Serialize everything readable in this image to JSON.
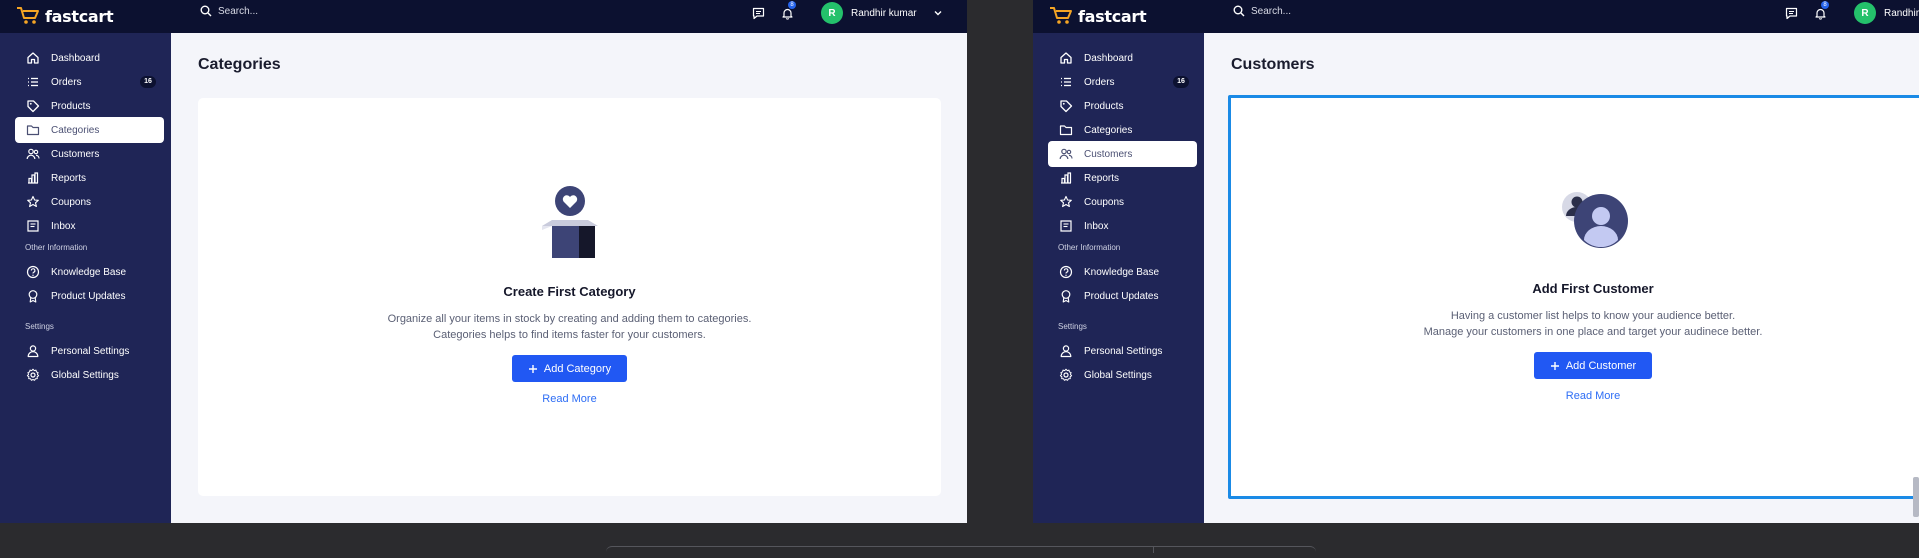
{
  "app": {
    "brand": "fastcart",
    "search_placeholder": "Search...",
    "notification_count": "8",
    "user": {
      "initial": "R",
      "name": "Randhir kumar",
      "name_clipped": "Randhir"
    }
  },
  "sidebar": {
    "items": [
      {
        "label": "Dashboard",
        "icon": "home-icon"
      },
      {
        "label": "Orders",
        "icon": "list-icon",
        "count": "16"
      },
      {
        "label": "Products",
        "icon": "tag-icon"
      },
      {
        "label": "Categories",
        "icon": "folder-icon"
      },
      {
        "label": "Customers",
        "icon": "users-icon"
      },
      {
        "label": "Reports",
        "icon": "bar-chart-icon"
      },
      {
        "label": "Coupons",
        "icon": "star-icon"
      },
      {
        "label": "Inbox",
        "icon": "inbox-icon"
      }
    ],
    "other_label": "Other Information",
    "other_items": [
      {
        "label": "Knowledge Base",
        "icon": "help-circle-icon"
      },
      {
        "label": "Product Updates",
        "icon": "award-icon"
      }
    ],
    "settings_label": "Settings",
    "settings_items": [
      {
        "label": "Personal Settings",
        "icon": "user-icon"
      },
      {
        "label": "Global Settings",
        "icon": "settings-icon"
      }
    ]
  },
  "categories_page": {
    "title": "Categories",
    "active_item": "Categories",
    "empty_title": "Create First Category",
    "empty_desc_line1": "Organize all your items in stock by creating and adding them to categories.",
    "empty_desc_line2": "Categories helps to find items faster for your customers.",
    "button_label": "Add Category",
    "link_label": "Read More"
  },
  "customers_page": {
    "title": "Customers",
    "active_item": "Customers",
    "empty_title": "Add First Customer",
    "empty_desc_line1": "Having a customer list helps to know your audience better.",
    "empty_desc_line2": "Manage your customers in one place and target your audinece better.",
    "button_label": "Add Customer",
    "link_label": "Read More"
  },
  "colors": {
    "topbar": "#0c1130",
    "sidebar": "#1f2556",
    "primary": "#2158f3",
    "selection": "#1a8ae6",
    "avatar": "#24c16b"
  }
}
